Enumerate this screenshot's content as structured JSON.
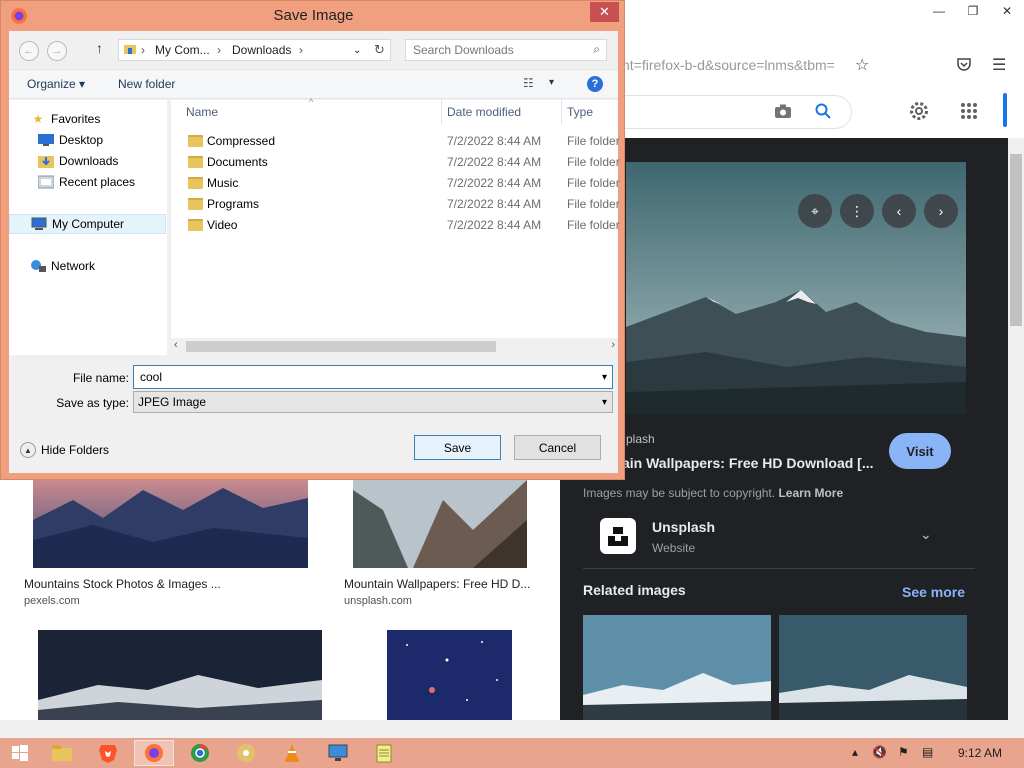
{
  "browser": {
    "url_fragment": "nt=firefox-b-d&source=lnms&tbm=",
    "win_controls": [
      "—",
      "❐",
      "✕"
    ],
    "panel": {
      "source": "plash",
      "title": "ain Wallpapers: Free HD Download [...",
      "visit": "Visit",
      "copyright_text": "Images may be subject to copyright.",
      "learn_more": "Learn More",
      "site_name": "Unsplash",
      "site_type": "Website",
      "related": "Related images",
      "see_more": "See more"
    },
    "results": [
      {
        "caption": "Mountains Stock Photos & Images ...",
        "source": "pexels.com"
      },
      {
        "caption": "Mountain Wallpapers: Free HD D...",
        "source": "unsplash.com"
      }
    ]
  },
  "dialog": {
    "title": "Save Image",
    "close": "✕",
    "breadcrumb": [
      "My Com...",
      "Downloads"
    ],
    "search_placeholder": "Search Downloads",
    "organize": "Organize",
    "new_folder": "New folder",
    "help": "?",
    "nav": [
      {
        "label": "Favorites",
        "icon": "star-icon"
      },
      {
        "label": "Desktop",
        "icon": "desktop-icon"
      },
      {
        "label": "Downloads",
        "icon": "downloads-icon"
      },
      {
        "label": "Recent places",
        "icon": "recent-places-icon"
      },
      {
        "label": "My Computer",
        "icon": "computer-icon"
      },
      {
        "label": "Network",
        "icon": "network-icon"
      }
    ],
    "columns": {
      "name": "Name",
      "date": "Date modified",
      "type": "Type"
    },
    "files": [
      {
        "name": "Compressed",
        "date": "7/2/2022 8:44 AM",
        "type": "File folder"
      },
      {
        "name": "Documents",
        "date": "7/2/2022 8:44 AM",
        "type": "File folder"
      },
      {
        "name": "Music",
        "date": "7/2/2022 8:44 AM",
        "type": "File folder"
      },
      {
        "name": "Programs",
        "date": "7/2/2022 8:44 AM",
        "type": "File folder"
      },
      {
        "name": "Video",
        "date": "7/2/2022 8:44 AM",
        "type": "File folder"
      }
    ],
    "file_name_label": "File name:",
    "file_name_value": "cool",
    "save_type_label": "Save as type:",
    "save_type_value": "JPEG Image",
    "hide_folders": "Hide Folders",
    "save": "Save",
    "cancel": "Cancel"
  },
  "taskbar": {
    "clock": "9:12 AM",
    "accent": "#e8a48c"
  }
}
